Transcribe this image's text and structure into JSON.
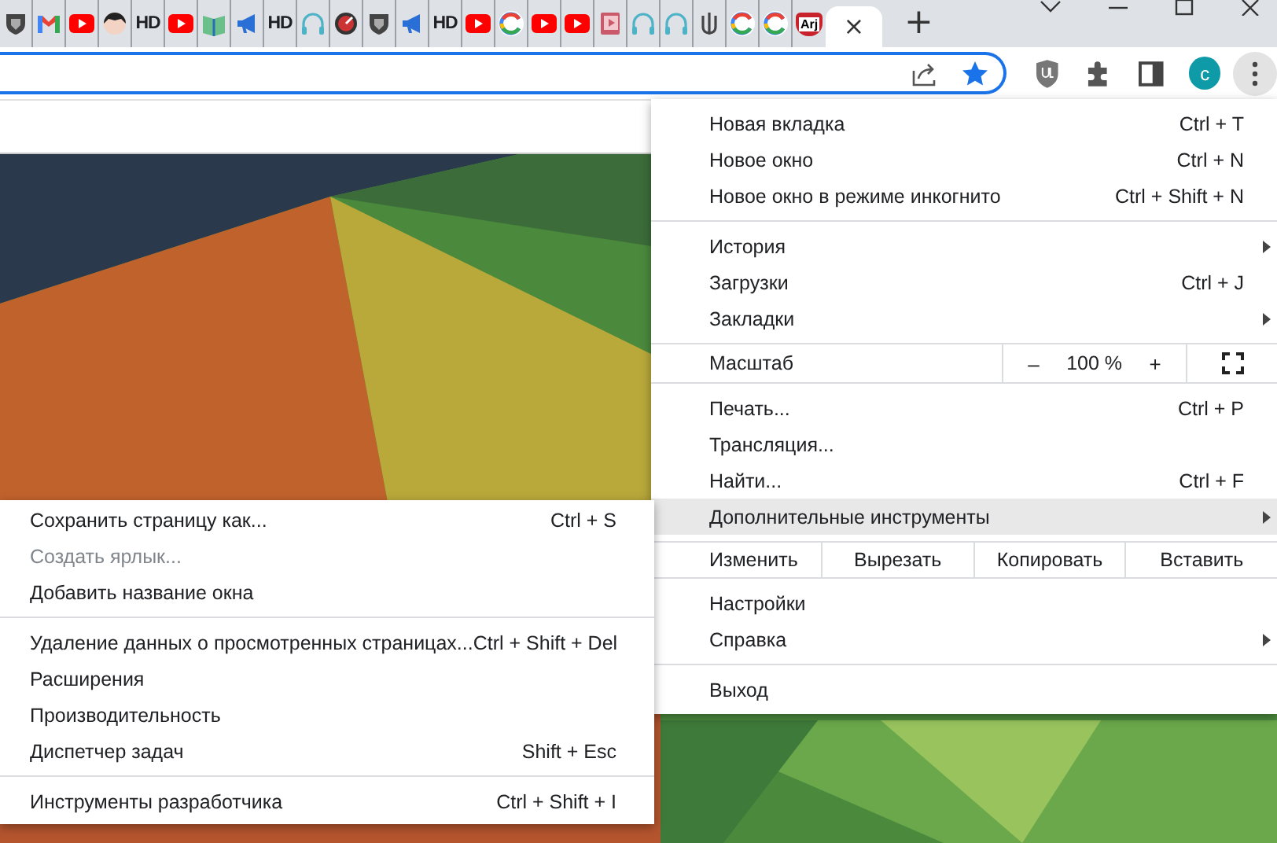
{
  "tabs": [
    {
      "kind": "shield",
      "selected": false
    },
    {
      "kind": "mail",
      "selected": false
    },
    {
      "kind": "video",
      "selected": false
    },
    {
      "kind": "head",
      "selected": false
    },
    {
      "kind": "text",
      "label": "HD",
      "selected": false
    },
    {
      "kind": "video",
      "selected": false
    },
    {
      "kind": "book",
      "selected": false
    },
    {
      "kind": "megaphone",
      "selected": false
    },
    {
      "kind": "text",
      "label": "HD",
      "selected": false
    },
    {
      "kind": "headphones",
      "selected": false
    },
    {
      "kind": "gauge",
      "selected": false
    },
    {
      "kind": "shield",
      "selected": false
    },
    {
      "kind": "megaphone",
      "selected": false
    },
    {
      "kind": "text",
      "label": "HD",
      "selected": false
    },
    {
      "kind": "video",
      "selected": false
    },
    {
      "kind": "ring",
      "selected": false
    },
    {
      "kind": "video",
      "selected": false
    },
    {
      "kind": "video",
      "selected": false
    },
    {
      "kind": "player",
      "selected": false
    },
    {
      "kind": "headphones",
      "selected": false
    },
    {
      "kind": "headphones",
      "selected": false
    },
    {
      "kind": "trident",
      "selected": false
    },
    {
      "kind": "ring",
      "selected": false
    },
    {
      "kind": "ring",
      "selected": false
    },
    {
      "kind": "heart",
      "label": "Arj",
      "selected": false
    },
    {
      "kind": "blank",
      "close": "×",
      "selected": true
    }
  ],
  "new_tab": "+",
  "toolbar": {
    "avatar": "c"
  },
  "menu": {
    "sections": [
      [
        {
          "kind": "item",
          "label": "Новая вкладка",
          "shortcut": "Ctrl + T",
          "has_submenu": false,
          "selected": false
        },
        {
          "kind": "item",
          "label": "Новое окно",
          "shortcut": "Ctrl + N",
          "has_submenu": false,
          "selected": false
        },
        {
          "kind": "item",
          "label": "Новое окно в режиме инкогнито",
          "shortcut": "Ctrl + Shift + N",
          "has_submenu": false,
          "selected": false
        }
      ],
      [
        {
          "kind": "item",
          "label": "История",
          "has_submenu": true,
          "selected": false
        },
        {
          "kind": "item",
          "label": "Загрузки",
          "shortcut": "Ctrl + J",
          "has_submenu": false,
          "selected": false
        },
        {
          "kind": "item",
          "label": "Закладки",
          "has_submenu": true,
          "selected": false
        }
      ],
      [
        {
          "kind": "zoom",
          "label": "Масштаб",
          "minus": "–",
          "value": "100 %",
          "plus": "+"
        }
      ],
      [
        {
          "kind": "item",
          "label": "Печать...",
          "shortcut": "Ctrl + P",
          "has_submenu": false,
          "selected": false
        },
        {
          "kind": "item",
          "label": "Трансляция...",
          "has_submenu": false,
          "selected": false
        },
        {
          "kind": "item",
          "label": "Найти...",
          "shortcut": "Ctrl + F",
          "has_submenu": false,
          "selected": false
        },
        {
          "kind": "item",
          "label": "Дополнительные инструменты",
          "has_submenu": true,
          "selected": true
        }
      ],
      [
        {
          "kind": "edit",
          "label": "Изменить",
          "buttons": [
            "Вырезать",
            "Копировать",
            "Вставить"
          ]
        }
      ],
      [
        {
          "kind": "item",
          "label": "Настройки",
          "has_submenu": false,
          "selected": false
        },
        {
          "kind": "item",
          "label": "Справка",
          "has_submenu": true,
          "selected": false
        }
      ],
      [
        {
          "kind": "item",
          "label": "Выход",
          "has_submenu": false,
          "selected": false
        }
      ]
    ]
  },
  "submenu": {
    "sections": [
      [
        {
          "label": "Сохранить страницу как...",
          "shortcut": "Ctrl + S",
          "disabled": false
        },
        {
          "label": "Создать ярлык...",
          "disabled": true
        },
        {
          "label": "Добавить название окна",
          "disabled": false
        }
      ],
      [
        {
          "label": "Удаление данных о просмотренных страницах...",
          "shortcut": "Ctrl + Shift + Del",
          "disabled": false
        },
        {
          "label": "Расширения",
          "disabled": false
        },
        {
          "label": "Производительность",
          "disabled": false
        },
        {
          "label": "Диспетчер задач",
          "shortcut": "Shift + Esc",
          "disabled": false
        }
      ],
      [
        {
          "label": "Инструменты разработчика",
          "shortcut": "Ctrl + Shift + I",
          "disabled": false
        }
      ]
    ]
  }
}
